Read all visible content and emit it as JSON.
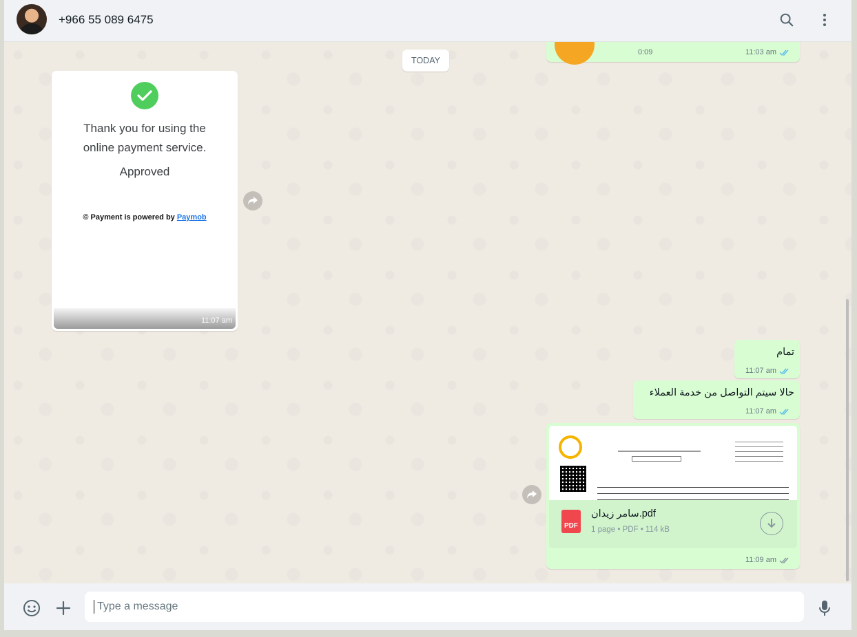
{
  "header": {
    "contact": "+966 55 089 6475",
    "icons": [
      "search-icon",
      "menu-icon"
    ]
  },
  "chat": {
    "date_divider": "TODAY",
    "voice_message": {
      "duration": "0:09",
      "time": "11:03 am",
      "status": "read"
    },
    "payment_card": {
      "line1": "Thank you for using the",
      "line2": "online payment service.",
      "status": "Approved",
      "powered_prefix": "Payment is powered by",
      "powered_link": "Paymob",
      "time": "11:07 am"
    },
    "messages": [
      {
        "text": "تمام",
        "time": "11:07 am",
        "status": "read"
      },
      {
        "text": "حالا سيتم التواصل من خدمة العملاء",
        "time": "11:07 am",
        "status": "read"
      }
    ],
    "document": {
      "filename": "سامر زيدان.pdf",
      "details": "1 page • PDF • 114 kB",
      "icon_label": "PDF",
      "time": "11:09 am",
      "status": "delivered"
    }
  },
  "footer": {
    "placeholder": "Type a message"
  },
  "colors": {
    "outgoing": "#d9fdd3",
    "read_tick": "#53bdeb",
    "check_green": "#4fce5d",
    "voice_avatar": "#f5a623"
  }
}
